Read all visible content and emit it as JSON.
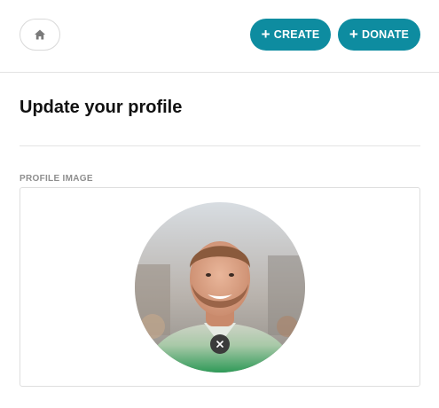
{
  "header": {
    "home_icon": "home-icon",
    "create_label": "CREATE",
    "donate_label": "DONATE",
    "plus_glyph": "+",
    "accent_color": "#0e8ca0"
  },
  "page": {
    "title": "Update your profile"
  },
  "profile_image": {
    "label": "PROFILE IMAGE",
    "remove_icon": "close-icon"
  }
}
